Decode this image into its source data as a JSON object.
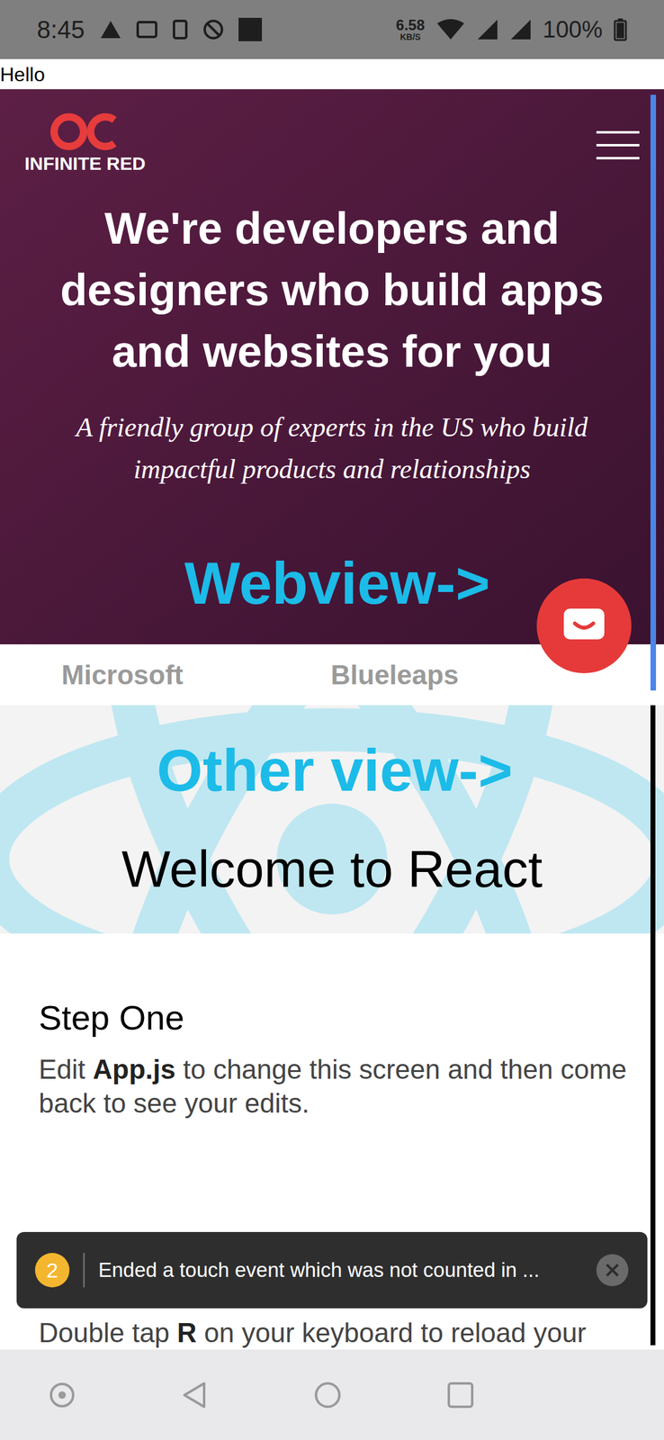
{
  "status_bar": {
    "time": "8:45",
    "speed": "6.58",
    "speed_unit": "KB/S",
    "battery": "100%"
  },
  "header_text": "Hello",
  "webview": {
    "logo": "INFINITE RED",
    "heading": "We're developers and designers who build apps and websites for you",
    "subtitle": "A friendly group of experts in the US who build impactful products and relationships",
    "clients": [
      "Microsoft",
      "Blueleaps"
    ]
  },
  "annotations": [
    {
      "label": "Webview->"
    },
    {
      "label": "Other view->"
    }
  ],
  "other_view": {
    "title": "Welcome to React",
    "sections": [
      {
        "title": "Step One",
        "body": [
          {
            "text": "Edit ",
            "bold": false
          },
          {
            "text": "App.js",
            "bold": true
          },
          {
            "text": " to change this screen and then come back to see your edits.",
            "bold": false
          }
        ]
      },
      {
        "title": "",
        "body": [
          {
            "text": "Double tap ",
            "bold": false
          },
          {
            "text": "R",
            "bold": true
          },
          {
            "text": " on your keyboard to reload your",
            "bold": false
          }
        ]
      }
    ]
  },
  "toast": {
    "count": "2",
    "message": "Ended a touch event which was not counted in ..."
  }
}
